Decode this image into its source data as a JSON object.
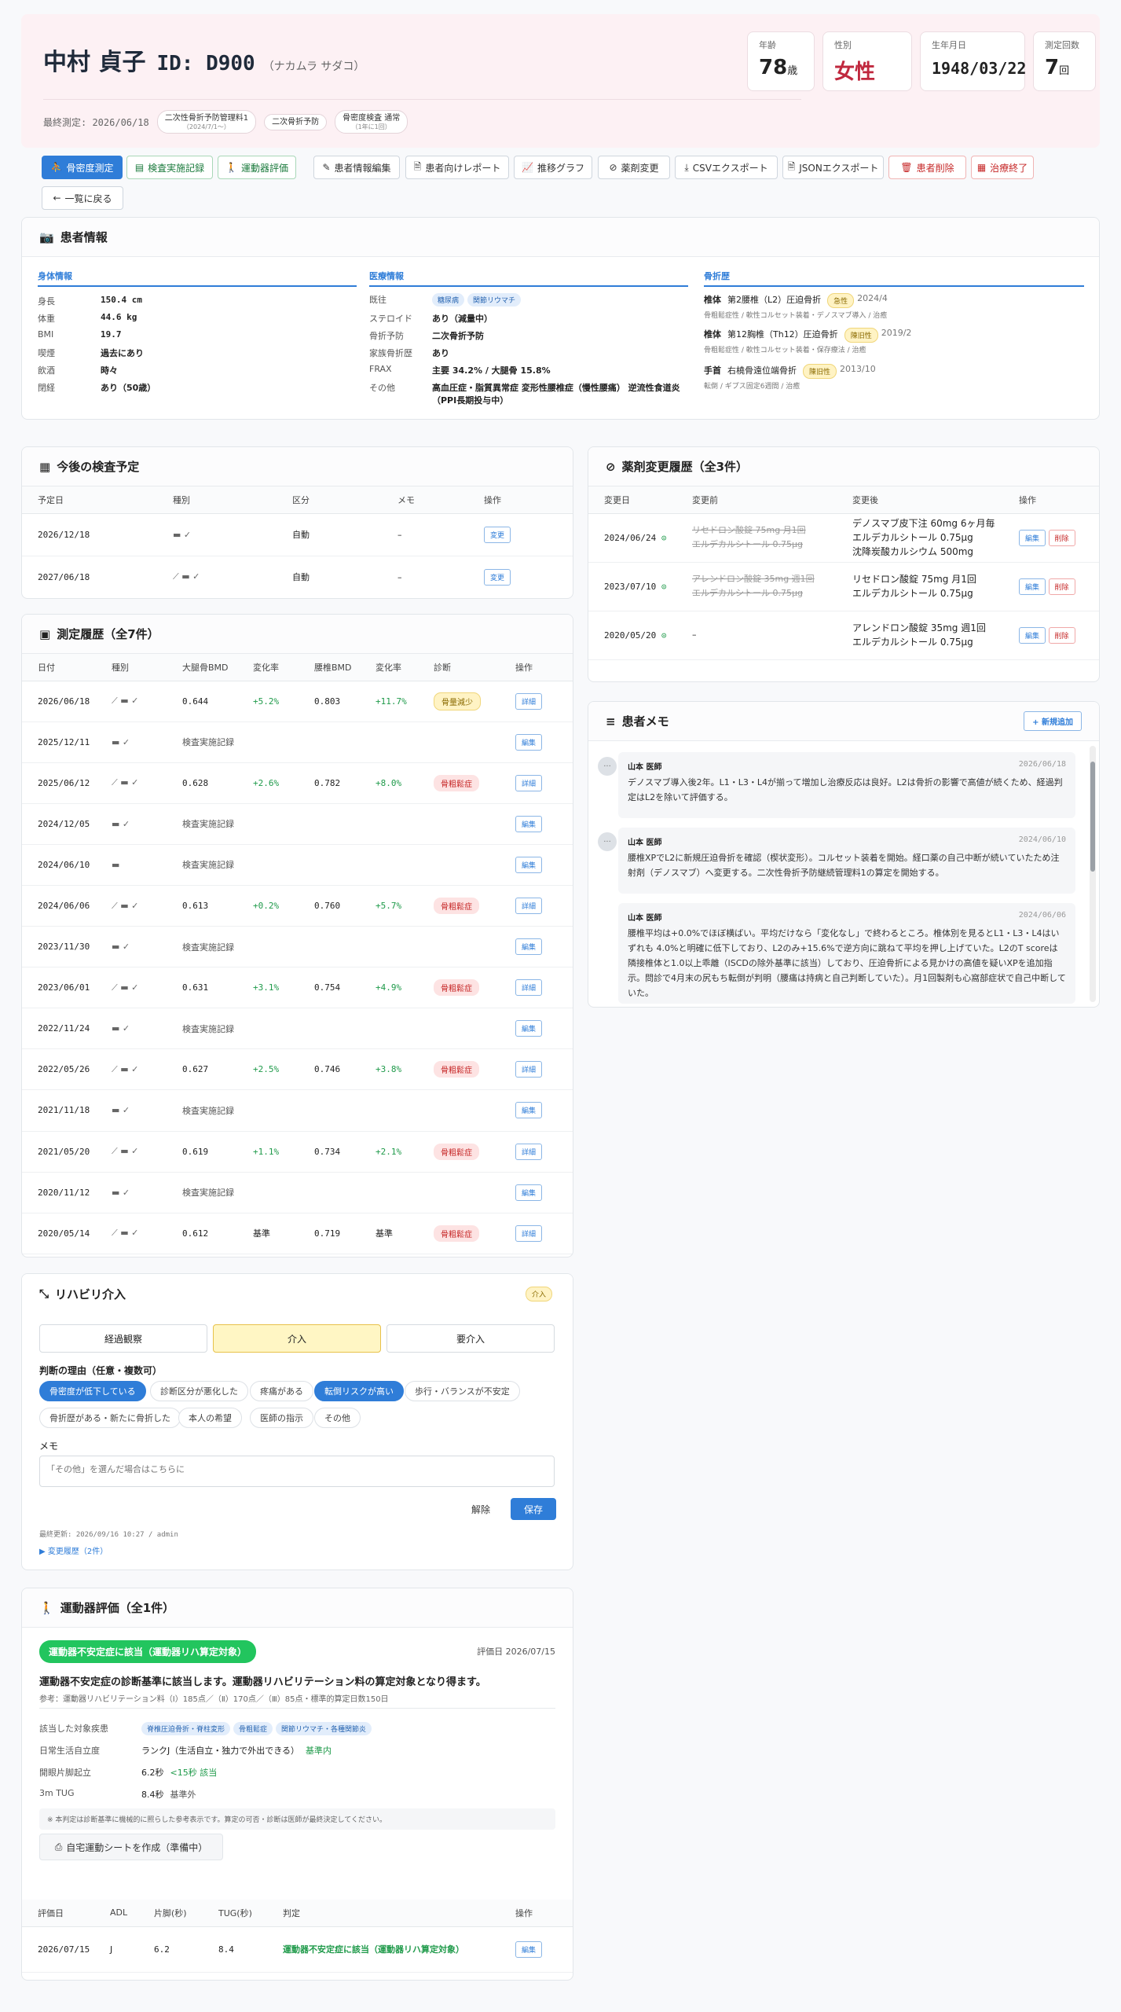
{
  "patient": {
    "name": "中村 貞子",
    "id_label": "ID: D900",
    "kana": "（ナカムラ サダコ）",
    "last_label": "最終測定: 2026/06/18",
    "tags": [
      {
        "t": "二次性骨折予防管理料1",
        "s": "（2024/7/1〜）"
      },
      {
        "t": "二次骨折予防",
        "s": ""
      },
      {
        "t": "骨密度検査 通常",
        "s": "（1年に1回）"
      }
    ]
  },
  "stats": [
    {
      "label": "年齢",
      "value": "78",
      "unit": "歳"
    },
    {
      "label": "性別",
      "value": "女性",
      "unit": ""
    },
    {
      "label": "生年月日",
      "value": "1948/03/22",
      "unit": ""
    },
    {
      "label": "測定回数",
      "value": "7",
      "unit": "回"
    }
  ],
  "toolbar": [
    "骨密度測定",
    "検査実施記録",
    "運動器評価",
    "患者情報編集",
    "患者向けレポート",
    "推移グラフ",
    "薬剤変更",
    "CSVエクスポート",
    "JSONエクスポート",
    "患者削除",
    "治療終了",
    "一覧に戻る"
  ],
  "info": {
    "title": "患者情報",
    "body_title": "身体情報",
    "body": [
      [
        "身長",
        "150.4 cm"
      ],
      [
        "体重",
        "44.6 kg"
      ],
      [
        "BMI",
        "19.7"
      ],
      [
        "喫煙",
        "過去にあり"
      ],
      [
        "飲酒",
        "時々"
      ],
      [
        "閉経",
        "あり（50歳）"
      ]
    ],
    "med_title": "医療情報",
    "med": {
      "hist_k": "既往",
      "hist": [
        "糖尿病",
        "関節リウマチ"
      ],
      "rows": [
        [
          "ステロイド",
          "あり（減量中）"
        ],
        [
          "骨折予防",
          "二次骨折予防"
        ],
        [
          "家族骨折歴",
          "あり"
        ],
        [
          "FRAX",
          "主要 34.2% / 大腿骨 15.8%"
        ]
      ],
      "other_k": "その他",
      "other": "高血圧症・脂質異常症 変形性腰椎症（慢性腰痛） 逆流性食道炎",
      "other2": "（PPI長期投与中）"
    },
    "fx_title": "骨折歴",
    "fx": [
      {
        "site": "椎体",
        "desc": "第2腰椎（L2）圧迫骨折",
        "badge": "急性",
        "date": "2024/4",
        "sub": "骨粗鬆症性 / 軟性コルセット装着・デノスマブ導入 / 治癒"
      },
      {
        "site": "椎体",
        "desc": "第12胸椎（Th12）圧迫骨折",
        "badge": "陳旧性",
        "date": "2019/2",
        "sub": "骨粗鬆症性 / 軟性コルセット装着・保存療法 / 治癒"
      },
      {
        "site": "手首",
        "desc": "右橈骨遠位端骨折",
        "badge": "陳旧性",
        "date": "2013/10",
        "sub": "転倒 / ギプス固定6週間 / 治癒"
      }
    ]
  },
  "sched": {
    "title": "今後の検査予定",
    "cols": [
      "予定日",
      "種別",
      "区分",
      "メモ",
      "操作"
    ],
    "rows": [
      {
        "d": "2026/12/18",
        "icon": "▬ ✓",
        "k": "自動",
        "m": "–",
        "b": "変更"
      },
      {
        "d": "2027/06/18",
        "icon": "⟋ ▬ ✓",
        "k": "自動",
        "m": "–",
        "b": "変更"
      }
    ]
  },
  "hist": {
    "title": "測定履歴（全7件）",
    "cols": [
      "日付",
      "種別",
      "大腿骨BMD",
      "変化率",
      "腰椎BMD",
      "変化率",
      "診断",
      "操作"
    ],
    "rows": [
      {
        "d": "2026/06/18",
        "i": "⟋ ▬ ✓",
        "f": "0.644",
        "fc": "+5.2%",
        "l": "0.803",
        "lc": "+11.7%",
        "dx": "骨量減少",
        "dt": "yl",
        "b": "詳細"
      },
      {
        "d": "2025/12/11",
        "i": "▬ ✓",
        "f": "検査実施記録",
        "fc": "",
        "l": "",
        "lc": "",
        "dx": "",
        "dt": "",
        "b": "編集"
      },
      {
        "d": "2025/06/12",
        "i": "⟋ ▬ ✓",
        "f": "0.628",
        "fc": "+2.6%",
        "l": "0.782",
        "lc": "+8.0%",
        "dx": "骨粗鬆症",
        "dt": "rd",
        "b": "詳細"
      },
      {
        "d": "2024/12/05",
        "i": "▬ ✓",
        "f": "検査実施記録",
        "fc": "",
        "l": "",
        "lc": "",
        "dx": "",
        "dt": "",
        "b": "編集"
      },
      {
        "d": "2024/06/10",
        "i": "▬",
        "f": "検査実施記録",
        "fc": "",
        "l": "",
        "lc": "",
        "dx": "",
        "dt": "",
        "b": "編集"
      },
      {
        "d": "2024/06/06",
        "i": "⟋ ▬ ✓",
        "f": "0.613",
        "fc": "+0.2%",
        "l": "0.760",
        "lc": "+5.7%",
        "dx": "骨粗鬆症",
        "dt": "rd",
        "b": "詳細"
      },
      {
        "d": "2023/11/30",
        "i": "▬ ✓",
        "f": "検査実施記録",
        "fc": "",
        "l": "",
        "lc": "",
        "dx": "",
        "dt": "",
        "b": "編集"
      },
      {
        "d": "2023/06/01",
        "i": "⟋ ▬ ✓",
        "f": "0.631",
        "fc": "+3.1%",
        "l": "0.754",
        "lc": "+4.9%",
        "dx": "骨粗鬆症",
        "dt": "rd",
        "b": "詳細"
      },
      {
        "d": "2022/11/24",
        "i": "▬ ✓",
        "f": "検査実施記録",
        "fc": "",
        "l": "",
        "lc": "",
        "dx": "",
        "dt": "",
        "b": "編集"
      },
      {
        "d": "2022/05/26",
        "i": "⟋ ▬ ✓",
        "f": "0.627",
        "fc": "+2.5%",
        "l": "0.746",
        "lc": "+3.8%",
        "dx": "骨粗鬆症",
        "dt": "rd",
        "b": "詳細"
      },
      {
        "d": "2021/11/18",
        "i": "▬ ✓",
        "f": "検査実施記録",
        "fc": "",
        "l": "",
        "lc": "",
        "dx": "",
        "dt": "",
        "b": "編集"
      },
      {
        "d": "2021/05/20",
        "i": "⟋ ▬ ✓",
        "f": "0.619",
        "fc": "+1.1%",
        "l": "0.734",
        "lc": "+2.1%",
        "dx": "骨粗鬆症",
        "dt": "rd",
        "b": "詳細"
      },
      {
        "d": "2020/11/12",
        "i": "▬ ✓",
        "f": "検査実施記録",
        "fc": "",
        "l": "",
        "lc": "",
        "dx": "",
        "dt": "",
        "b": "編集"
      },
      {
        "d": "2020/05/14",
        "i": "⟋ ▬ ✓",
        "f": "0.612",
        "fc": "基準",
        "l": "0.719",
        "lc": "基準",
        "dx": "骨粗鬆症",
        "dt": "rd",
        "b": "詳細"
      }
    ]
  },
  "meds": {
    "title": "薬剤変更履歴（全3件）",
    "cols": [
      "変更日",
      "変更前",
      "変更後",
      "操作"
    ],
    "edit": "編集",
    "del": "削除",
    "rows": [
      {
        "d": "2024/06/24",
        "before": [
          "リセドロン酸錠 75mg 月1回",
          "エルデカルシトール 0.75μg"
        ],
        "after": [
          "デノスマブ皮下注 60mg 6ヶ月毎",
          "エルデカルシトール 0.75μg",
          "沈降炭酸カルシウム 500mg"
        ]
      },
      {
        "d": "2023/07/10",
        "before": [
          "アレンドロン酸錠 35mg 週1回",
          "エルデカルシトール 0.75μg"
        ],
        "after": [
          "リセドロン酸錠 75mg 月1回",
          "エルデカルシトール 0.75μg"
        ]
      },
      {
        "d": "2020/05/20",
        "before": [
          "–"
        ],
        "after": [
          "アレンドロン酸錠 35mg 週1回",
          "エルデカルシトール 0.75μg"
        ]
      }
    ]
  },
  "memos": {
    "title": "患者メモ",
    "add": "+ 新規追加",
    "items": [
      {
        "author": "山本 医師",
        "date": "2026/06/18",
        "text": "デノスマブ導入後2年。L1・L3・L4が揃って増加し治療反応は良好。L2は骨折の影響で高値が続くため、経過判定はL2を除いて評価する。"
      },
      {
        "author": "山本 医師",
        "date": "2024/06/10",
        "text": "腰椎XPでL2に新規圧迫骨折を確認（楔状変形）。コルセット装着を開始。経口薬の自己中断が続いていたため注射剤（デノスマブ）へ変更する。二次性骨折予防継続管理料1の算定を開始する。"
      },
      {
        "author": "山本 医師",
        "date": "2024/06/06",
        "text": "腰椎平均は+0.0%でほぼ横ばい。平均だけなら「変化なし」で終わるところ。椎体別を見るとL1・L3・L4はいずれも 4.0%と明確に低下しており、L2のみ+15.6%で逆方向に跳ねて平均を押し上げていた。L2のT scoreは隣接椎体と1.0以上乖離（ISCDの除外基準に該当）しており、圧迫骨折による見かけの高値を疑いXPを追加指示。問診で4月末の尻もち転倒が判明（腰痛は持病と自己判断していた）。月1回製剤も心窩部症状で自己中断していた。"
      }
    ]
  },
  "rehab": {
    "title": "リハビリ介入",
    "badge": "介入",
    "segs": [
      "経過観察",
      "介入",
      "要介入"
    ],
    "reason": "判断の理由（任意・複数可）",
    "pills": [
      "骨密度が低下している",
      "診断区分が悪化した",
      "疼痛がある",
      "転倒リスクが高い",
      "歩行・バランスが不安定",
      "骨折歴がある・新たに骨折した",
      "本人の希望",
      "医師の指示",
      "その他"
    ],
    "memo_label": "メモ",
    "placeholder": "「その他」を選んだ場合はこちらに",
    "clear": "解除",
    "save": "保存",
    "updated": "最終更新: 2026/09/16 10:27 / admin",
    "history": "▶ 変更履歴（2件）"
  },
  "motor": {
    "title": "運動器評価（全1件）",
    "banner": "運動器不安定症に該当（運動器リハ算定対象）",
    "date": "評価日 2026/07/15",
    "headline": "運動器不安定症の診断基準に該当します。運動器リハビリテーション料の算定対象となり得ます。",
    "ref": "参考：運動器リハビリテーション料（Ⅰ）185点／（Ⅱ）170点／（Ⅲ）85点・標準的算定日数150日",
    "disease_k": "該当した対象疾患",
    "diseases": [
      "脊椎圧迫骨折・脊柱変形",
      "骨粗鬆症",
      "関節リウマチ・各種関節炎"
    ],
    "adl_k": "日常生活自立度",
    "adl_v": "ランクJ（生活自立・独力で外出できる）",
    "adl_s": "基準内",
    "leg_k": "開眼片脚起立",
    "leg_v": "6.2秒",
    "leg_s": "<15秒 該当",
    "tug_k": "3m TUG",
    "tug_v": "8.4秒",
    "tug_s": "基準外",
    "note": "※ 本判定は診断基準に機械的に照らした参考表示です。算定の可否・診断は医師が最終決定してください。",
    "print": "自宅運動シートを作成（準備中）",
    "cols": [
      "評価日",
      "ADL",
      "片脚(秒)",
      "TUG(秒)",
      "判定",
      "操作"
    ],
    "row": {
      "d": "2026/07/15",
      "adl": "J",
      "leg": "6.2",
      "tug": "8.4",
      "j": "運動器不安定症に該当（運動器リハ算定対象）",
      "b": "編集"
    }
  },
  "colors": {
    "accent": "#2f7dd8",
    "female": "#c0283e",
    "green": "#1f9a4a"
  }
}
